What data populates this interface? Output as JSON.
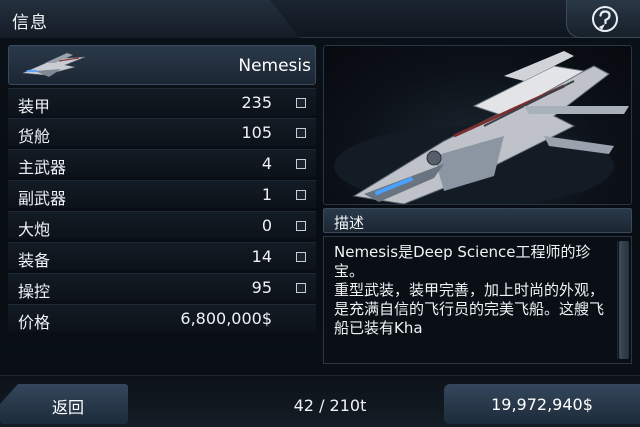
{
  "header": {
    "title": "信息"
  },
  "ship": {
    "name": "Nemesis"
  },
  "stats": [
    {
      "label": "装甲",
      "value": "235"
    },
    {
      "label": "货舱",
      "value": "105"
    },
    {
      "label": "主武器",
      "value": "4"
    },
    {
      "label": "副武器",
      "value": "1"
    },
    {
      "label": "大炮",
      "value": "0"
    },
    {
      "label": "装备",
      "value": "14"
    },
    {
      "label": "操控",
      "value": "95"
    }
  ],
  "price": {
    "label": "价格",
    "value": "6,800,000$"
  },
  "description": {
    "title": "描述",
    "text": "Nemesis是Deep Science工程师的珍宝。\n重型武装，装甲完善，加上时尚的外观，是充满自信的飞行员的完美飞船。这艘飞船已装有Kha"
  },
  "footer": {
    "back_label": "返回",
    "cargo": "42 / 210t",
    "credits": "19,972,940$"
  },
  "colors": {
    "panel": "#1b2633",
    "accent": "#34475b"
  },
  "icons": {
    "help": "question-mark-icon",
    "checkbox": "checkbox-icon"
  }
}
